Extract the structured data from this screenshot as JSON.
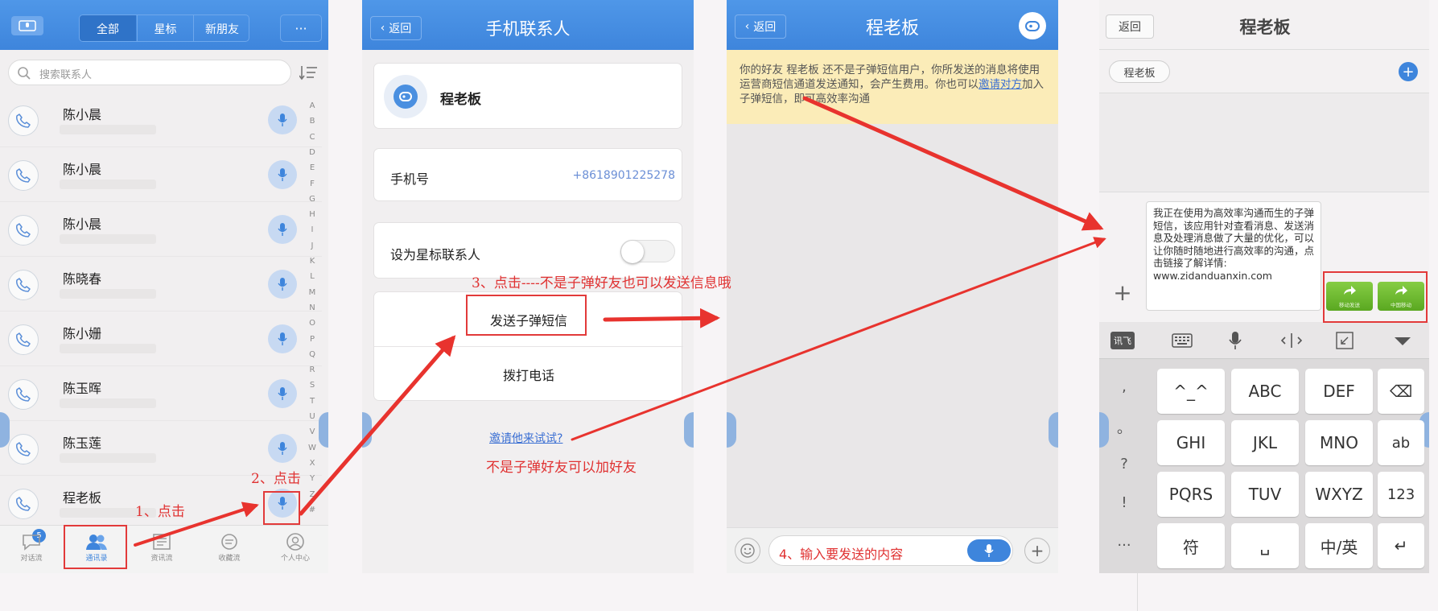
{
  "colors": {
    "accent": "#3e85dc",
    "annotation": "#e23a3a",
    "link": "#3a6fd3",
    "warn_bg": "#fbecb8",
    "green": "#6fbf2e"
  },
  "panel1": {
    "header": {
      "tabs": [
        "全部",
        "星标",
        "新朋友"
      ],
      "more": "···"
    },
    "search": {
      "placeholder": "搜索联系人"
    },
    "contacts": [
      {
        "name": "陈小晨"
      },
      {
        "name": "陈小晨"
      },
      {
        "name": "陈小晨"
      },
      {
        "name": "陈晓春"
      },
      {
        "name": "陈小姗"
      },
      {
        "name": "陈玉晖"
      },
      {
        "name": "陈玉莲"
      },
      {
        "name": "程老板"
      }
    ],
    "index_letters": [
      "A",
      "B",
      "C",
      "D",
      "E",
      "F",
      "G",
      "H",
      "I",
      "J",
      "K",
      "L",
      "M",
      "N",
      "O",
      "P",
      "Q",
      "R",
      "S",
      "T",
      "U",
      "V",
      "W",
      "X",
      "Y",
      "Z",
      "#"
    ],
    "nav": [
      {
        "label": "对话流",
        "icon": "chat-icon",
        "badge": "5"
      },
      {
        "label": "通讯录",
        "icon": "contacts-icon"
      },
      {
        "label": "资讯流",
        "icon": "news-icon"
      },
      {
        "label": "收藏流",
        "icon": "favorites-icon"
      },
      {
        "label": "个人中心",
        "icon": "profile-icon"
      }
    ],
    "annotation_1": "1、点击",
    "annotation_2": "2、点击"
  },
  "panel2": {
    "back": "返回",
    "title": "手机联系人",
    "contact_name": "程老板",
    "phone_label": "手机号",
    "phone_value": "+8618901225278",
    "star_label": "设为星标联系人",
    "send_sms": "发送子弹短信",
    "call": "拨打电话",
    "invite_link": "邀请他来试试?",
    "annotation_3": "3、点击----不是子弹好友也可以发送信息哦",
    "annotation_invite": "不是子弹好友可以加好友"
  },
  "panel3": {
    "back": "返回",
    "title": "程老板",
    "notice_pre": "你的好友 程老板 还不是子弹短信用户，你所发送的消息将使用运营商短信通道发送通知，会产生费用。你也可以",
    "notice_link": "邀请对方",
    "notice_post": "加入子弹短信，即可高效率沟通",
    "input_placeholder": "4、输入要发送的内容"
  },
  "panel4": {
    "back": "返回",
    "title": "程老板",
    "recipient": "程老板",
    "message": "我正在使用为高效率沟通而生的子弹短信，该应用针对查看消息、发送消息及处理消息做了大量的优化，可以让你随时随地进行高效率的沟通，点击链接了解详情:",
    "message_url": "www.zidanduanxin.com",
    "send_btn_1": "移动发送",
    "send_btn_2": "中国移动",
    "ime_label": "讯飞",
    "side_keys": [
      ",",
      "。",
      "?",
      "!",
      "..."
    ],
    "keys": [
      [
        "^_^",
        "ABC",
        "DEF",
        "⌫"
      ],
      [
        "GHI",
        "JKL",
        "MNO",
        "ab"
      ],
      [
        "PQRS",
        "TUV",
        "WXYZ",
        "123"
      ],
      [
        "符",
        "␣",
        "中/英",
        "↵"
      ]
    ]
  }
}
